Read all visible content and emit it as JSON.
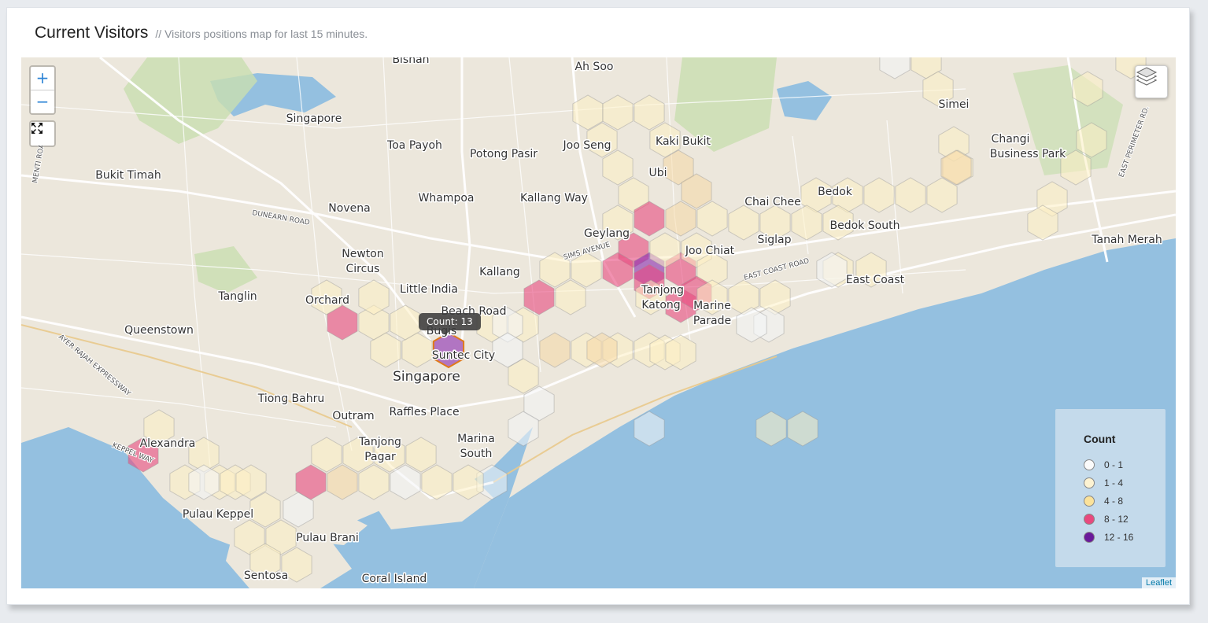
{
  "header": {
    "title": "Current Visitors",
    "subtitle": "// Visitors positions map for last 15 minutes."
  },
  "controls": {
    "zoom_in": "+",
    "zoom_out": "−",
    "fullscreen_icon": "fullscreen-icon",
    "layers_icon": "layers-icon"
  },
  "tooltip": {
    "text": "Count: 13"
  },
  "attribution": "Leaflet",
  "legend": {
    "title": "Count",
    "items": [
      {
        "label": "0 - 1",
        "color": "#fbfbfb"
      },
      {
        "label": "1 - 4",
        "color": "#fdf3d2"
      },
      {
        "label": "4 - 8",
        "color": "#fbe29a"
      },
      {
        "label": "8 - 12",
        "color": "#e8497e"
      },
      {
        "label": "12 - 16",
        "color": "#6a1a9a"
      }
    ]
  },
  "places": [
    {
      "name": "Bishan",
      "size": 14
    },
    {
      "name": "Ah Soo",
      "size": 14
    },
    {
      "name": "Singapore",
      "size": 14
    },
    {
      "name": "Toa Payoh",
      "size": 14
    },
    {
      "name": "Potong Pasir",
      "size": 14
    },
    {
      "name": "Joo Seng",
      "size": 14
    },
    {
      "name": "Kaki Bukit",
      "size": 14
    },
    {
      "name": "Simei",
      "size": 14
    },
    {
      "name": "Changi",
      "size": 14
    },
    {
      "name": "Business Park",
      "size": 14
    },
    {
      "name": "Bukit Timah",
      "size": 14
    },
    {
      "name": "Ubi",
      "size": 14
    },
    {
      "name": "Whampoa",
      "size": 14
    },
    {
      "name": "Kallang Way",
      "size": 14
    },
    {
      "name": "Bedok",
      "size": 14
    },
    {
      "name": "Novena",
      "size": 14
    },
    {
      "name": "Chai Chee",
      "size": 14
    },
    {
      "name": "Bedok South",
      "size": 14
    },
    {
      "name": "Geylang",
      "size": 14
    },
    {
      "name": "Siglap",
      "size": 14
    },
    {
      "name": "Tanah Merah",
      "size": 14
    },
    {
      "name": "Newton",
      "size": 14
    },
    {
      "name": "Circus",
      "size": 14
    },
    {
      "name": "Joo Chiat",
      "size": 14
    },
    {
      "name": "Kallang",
      "size": 14
    },
    {
      "name": "East Coast",
      "size": 14
    },
    {
      "name": "Little India",
      "size": 14
    },
    {
      "name": "Tanglin",
      "size": 14
    },
    {
      "name": "Orchard",
      "size": 14
    },
    {
      "name": "Tanjong",
      "size": 14
    },
    {
      "name": "Katong",
      "size": 14
    },
    {
      "name": "Marine",
      "size": 14
    },
    {
      "name": "Parade",
      "size": 14
    },
    {
      "name": "Beach Road",
      "size": 14
    },
    {
      "name": "Queenstown",
      "size": 14
    },
    {
      "name": "Bugis",
      "size": 14
    },
    {
      "name": "Suntec City",
      "size": 14
    },
    {
      "name": "Singapore",
      "size": 17
    },
    {
      "name": "Tiong Bahru",
      "size": 14
    },
    {
      "name": "Outram",
      "size": 14
    },
    {
      "name": "Raffles Place",
      "size": 14
    },
    {
      "name": "Tanjong",
      "size": 14
    },
    {
      "name": "Pagar",
      "size": 14
    },
    {
      "name": "Marina",
      "size": 14
    },
    {
      "name": "South",
      "size": 14
    },
    {
      "name": "Alexandra",
      "size": 14
    },
    {
      "name": "Pulau Keppel",
      "size": 14
    },
    {
      "name": "Pulau Brani",
      "size": 14
    },
    {
      "name": "Sentosa",
      "size": 14
    },
    {
      "name": "Coral Island",
      "size": 14
    }
  ],
  "roads": [
    {
      "name": "DUNEARN ROAD"
    },
    {
      "name": "SIMS AVENUE"
    },
    {
      "name": "EAST COAST ROAD"
    },
    {
      "name": "AYER RAJAH EXPRESSWAY"
    },
    {
      "name": "KEPPEL WAY"
    },
    {
      "name": "EAST PERIMETER RD."
    },
    {
      "name": "MENTI ROAD"
    }
  ],
  "hexbins": [
    {
      "count": 1
    },
    {
      "count": 2
    },
    {
      "count": 2
    },
    {
      "count": 2
    },
    {
      "count": 3
    },
    {
      "count": 2
    },
    {
      "count": 2
    },
    {
      "count": 3
    },
    {
      "count": 2
    },
    {
      "count": 2
    },
    {
      "count": 3
    },
    {
      "count": 6
    },
    {
      "count": 3
    },
    {
      "count": 2
    },
    {
      "count": 3
    },
    {
      "count": 3
    },
    {
      "count": 6
    },
    {
      "count": 5
    },
    {
      "count": 2
    },
    {
      "count": 2
    },
    {
      "count": 3
    },
    {
      "count": 2
    },
    {
      "count": 3
    },
    {
      "count": 2
    },
    {
      "count": 2
    },
    {
      "count": 9
    },
    {
      "count": 5
    },
    {
      "count": 3
    },
    {
      "count": 2
    },
    {
      "count": 2
    },
    {
      "count": 2
    },
    {
      "count": 2
    },
    {
      "count": 3
    },
    {
      "count": 2
    },
    {
      "count": 9
    },
    {
      "count": 14
    },
    {
      "count": 9
    },
    {
      "count": 3
    },
    {
      "count": 2
    },
    {
      "count": 3
    },
    {
      "count": 9
    },
    {
      "count": 9
    },
    {
      "count": 3
    },
    {
      "count": 9
    },
    {
      "count": 9
    },
    {
      "count": 3
    },
    {
      "count": 1
    },
    {
      "count": 2
    },
    {
      "count": 9
    },
    {
      "count": 3
    },
    {
      "count": 3
    },
    {
      "count": 3
    },
    {
      "count": 3
    },
    {
      "count": 2
    },
    {
      "count": 0
    },
    {
      "count": 3
    },
    {
      "count": 2
    },
    {
      "count": 13
    },
    {
      "count": 3
    },
    {
      "count": 2
    },
    {
      "count": 6
    },
    {
      "count": 3
    },
    {
      "count": 3
    },
    {
      "count": 6
    },
    {
      "count": 2
    },
    {
      "count": 2
    },
    {
      "count": 1
    },
    {
      "count": 1
    },
    {
      "count": 2
    },
    {
      "count": 2
    },
    {
      "count": 0
    },
    {
      "count": 0
    },
    {
      "count": 0
    },
    {
      "count": 0
    },
    {
      "count": 1
    },
    {
      "count": 9
    },
    {
      "count": 2
    },
    {
      "count": 2
    },
    {
      "count": 2
    },
    {
      "count": 2
    },
    {
      "count": 2
    },
    {
      "count": 9
    },
    {
      "count": 2
    },
    {
      "count": 2
    },
    {
      "count": 2
    },
    {
      "count": 2
    },
    {
      "count": 2
    },
    {
      "count": 1
    },
    {
      "count": 2
    },
    {
      "count": 1
    },
    {
      "count": 9
    },
    {
      "count": 5
    },
    {
      "count": 2
    },
    {
      "count": 1
    },
    {
      "count": 2
    },
    {
      "count": 2
    },
    {
      "count": 2
    },
    {
      "count": 2
    },
    {
      "count": 2
    },
    {
      "count": 3
    },
    {
      "count": 2
    },
    {
      "count": 3
    },
    {
      "count": 2
    },
    {
      "count": 3
    },
    {
      "count": 2
    },
    {
      "count": 2
    },
    {
      "count": 3
    }
  ]
}
